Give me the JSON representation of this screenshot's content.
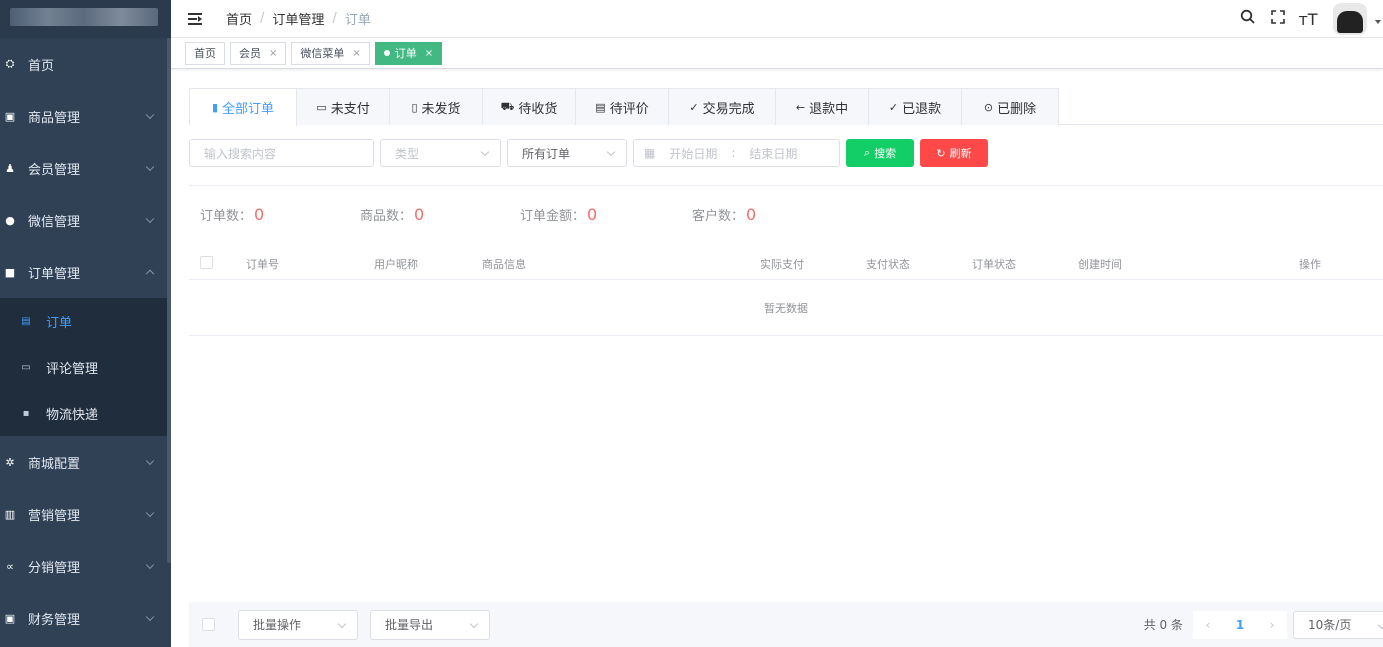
{
  "sidebar": {
    "items": [
      {
        "label": "首页",
        "icon": "dashboard-icon",
        "glyph": "⛭"
      },
      {
        "label": "商品管理",
        "icon": "goods-icon",
        "glyph": "▣"
      },
      {
        "label": "会员管理",
        "icon": "users-icon",
        "glyph": "♟"
      },
      {
        "label": "微信管理",
        "icon": "wechat-icon",
        "glyph": "●"
      },
      {
        "label": "订单管理",
        "icon": "lock-icon",
        "glyph": "■"
      }
    ],
    "submenu": [
      {
        "label": "订单",
        "icon": "order-icon",
        "glyph": "▤"
      },
      {
        "label": "评论管理",
        "icon": "comment-icon",
        "glyph": "▭"
      },
      {
        "label": "物流快递",
        "icon": "truck-icon",
        "glyph": "▪"
      }
    ],
    "items2": [
      {
        "label": "商城配置",
        "icon": "gear-icon",
        "glyph": "✲"
      },
      {
        "label": "营销管理",
        "icon": "chart-icon",
        "glyph": "▥"
      },
      {
        "label": "分销管理",
        "icon": "share-icon",
        "glyph": "∝"
      },
      {
        "label": "财务管理",
        "icon": "finance-icon",
        "glyph": "▣"
      }
    ]
  },
  "breadcrumb": [
    "首页",
    "订单管理",
    "订单"
  ],
  "breadcrumb_sep": "/",
  "toolbar": {
    "search_glyph": "🔍",
    "fullscreen_glyph": "⛶",
    "fontsize_glyph": "тT"
  },
  "tags": [
    {
      "label": "首页",
      "closable": false
    },
    {
      "label": "会员",
      "closable": true
    },
    {
      "label": "微信菜单",
      "closable": true
    },
    {
      "label": "订单",
      "closable": true,
      "active": true
    }
  ],
  "tag_close": "×",
  "tabs": [
    {
      "label": "全部订单",
      "glyph": "▮",
      "active": true
    },
    {
      "label": "未支付",
      "glyph": "▭"
    },
    {
      "label": "未发货",
      "glyph": "▯"
    },
    {
      "label": "待收货",
      "glyph": "⛟"
    },
    {
      "label": "待评价",
      "glyph": "▤"
    },
    {
      "label": "交易完成",
      "glyph": "✓"
    },
    {
      "label": "退款中",
      "glyph": "←"
    },
    {
      "label": "已退款",
      "glyph": "✓"
    },
    {
      "label": "已删除",
      "glyph": "⊙"
    }
  ],
  "filters": {
    "search_placeholder": "输入搜索内容",
    "type_placeholder": "类型",
    "order_select": "所有订单",
    "start_date": "开始日期",
    "date_sep": ":",
    "end_date": "结束日期",
    "calendar_glyph": "▦",
    "search_btn": "搜索",
    "search_btn_glyph": "⌕",
    "refresh_btn": "刷新",
    "refresh_btn_glyph": "↻"
  },
  "stats": [
    {
      "label": "订单数：",
      "value": "0"
    },
    {
      "label": "商品数：",
      "value": "0"
    },
    {
      "label": "订单金额：",
      "value": "0"
    },
    {
      "label": "客户数：",
      "value": "0"
    }
  ],
  "table": {
    "columns": [
      "订单号",
      "用户昵称",
      "商品信息",
      "实际支付",
      "支付状态",
      "订单状态",
      "创建时间",
      "操作"
    ],
    "empty_text": "暂无数据"
  },
  "footer": {
    "batch_ops": "批量操作",
    "batch_export": "批量导出",
    "total": "共 0 条",
    "page": "1",
    "page_size": "10条/页",
    "prev": "‹",
    "next": "›"
  },
  "colors": {
    "primary": "#409eff",
    "success": "#13ce66",
    "danger": "#ff4949",
    "sidebar_bg": "#304156",
    "tag_active": "#42b983"
  }
}
